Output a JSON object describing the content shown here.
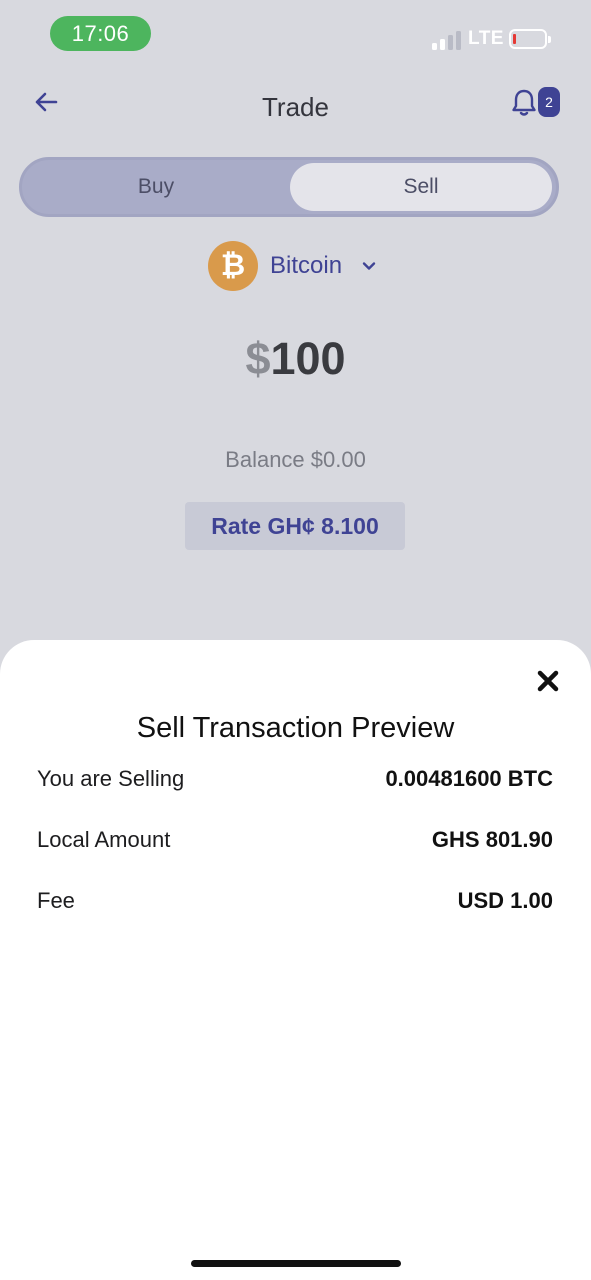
{
  "status_bar": {
    "time": "17:06",
    "network": "LTE"
  },
  "header": {
    "title": "Trade",
    "notification_count": "2"
  },
  "trade_tabs": {
    "buy_label": "Buy",
    "sell_label": "Sell",
    "selected": "Sell"
  },
  "coin": {
    "name": "Bitcoin",
    "symbol_glyph": "₿"
  },
  "amount": {
    "currency_symbol": "$",
    "value": "100"
  },
  "balance_text": "Balance $0.00",
  "rate_text": "Rate GH¢ 8.100",
  "preview_sheet": {
    "title": "Sell Transaction Preview",
    "rows": [
      {
        "label": "You are Selling",
        "value": "0.00481600 BTC"
      },
      {
        "label": "Local Amount",
        "value": "GHS 801.90"
      },
      {
        "label": "Fee",
        "value": "USD 1.00"
      }
    ]
  },
  "colors": {
    "accent": "#3f4394",
    "status_green": "#4db55e",
    "bitcoin_orange": "#d99a4b",
    "overlay_background": "#d8d9df"
  },
  "icons": {
    "back": "arrow-left-icon",
    "notifications": "bell-icon",
    "coin_dropdown": "chevron-down-icon",
    "close": "close-icon"
  }
}
